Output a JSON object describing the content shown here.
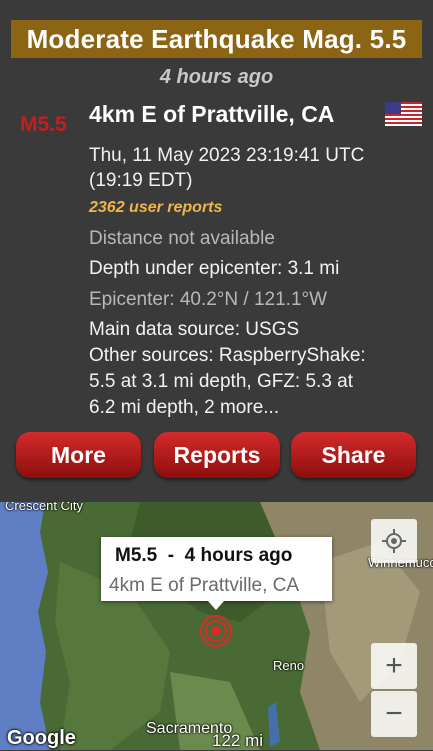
{
  "header": {
    "title": "Moderate Earthquake Mag. 5.5",
    "time_ago": "4 hours ago"
  },
  "quake": {
    "magnitude": "M5.5",
    "place": "4km E of Prattville, CA",
    "flag_icon": "us-flag-icon",
    "datetime_utc": "Thu, 11 May 2023 23:19:41 UTC",
    "datetime_local": "(19:19 EDT)",
    "user_reports": "2362 user reports",
    "distance": "Distance not available",
    "depth": "Depth under epicenter: 3.1 mi",
    "epicenter": "Epicenter: 40.2°N / 121.1°W",
    "main_source": "Main data source: USGS",
    "other_sources_1": "Other sources: RaspberryShake:",
    "other_sources_2": "5.5 at 3.1 mi depth, GFZ: 5.3 at",
    "other_sources_3": "6.2 mi depth, 2 more..."
  },
  "actions": {
    "more": "More",
    "reports": "Reports",
    "share": "Share"
  },
  "map": {
    "callout_title": "M5.5  -  4 hours ago",
    "callout_place": "4km E of Prattville, CA",
    "labels": {
      "crescent_city": "Crescent City",
      "winnemucca": "Winnemucc",
      "reno": "Reno",
      "sacramento": "Sacramento"
    },
    "zoom_in": "+",
    "zoom_out": "−",
    "attribution": "Google",
    "scale": "122 mi"
  },
  "colors": {
    "title_bg": "#8b6414",
    "magnitude": "#c41e1e",
    "reports": "#f0b44a",
    "button": "#b81818"
  }
}
